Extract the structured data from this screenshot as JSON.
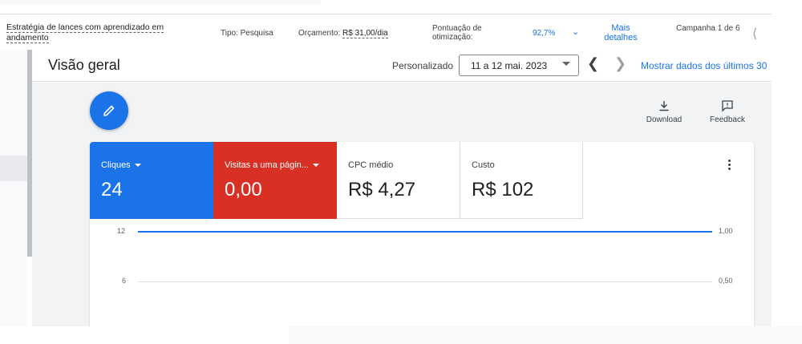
{
  "topbar": {
    "strategy": "Estratégia de lances com aprendizado em andamento",
    "type": "Tipo: Pesquisa",
    "budget_label": "Orçamento: ",
    "budget_value": "R$ 31,00/dia",
    "score_label": "Pontuação de otimização:",
    "score_value": "92,7%",
    "more_details": "Mais detalhes",
    "campaign": "Campanha 1 de 6"
  },
  "header": {
    "title": "Visão geral",
    "custom_label": "Personalizado",
    "date_range": "11 a 12 mai. 2023",
    "show_last": "Mostrar dados dos últimos 30"
  },
  "tools": {
    "download": "Download",
    "feedback": "Feedback"
  },
  "metrics": [
    {
      "label": "Cliques",
      "value": "24",
      "color": "#1a73e8"
    },
    {
      "label": "Visitas a uma págin...",
      "value": "0,00",
      "color": "#d93025"
    },
    {
      "label": "CPC médio",
      "value": "R$ 4,27"
    },
    {
      "label": "Custo",
      "value": "R$ 102"
    }
  ],
  "chart_data": {
    "type": "line",
    "left_axis_ticks": [
      "12",
      "6"
    ],
    "right_axis_ticks": [
      "1,00",
      "0,50"
    ],
    "series": [
      {
        "values": [
          12,
          12
        ]
      }
    ]
  },
  "colors": {
    "accent": "#1a73e8",
    "alert": "#d93025"
  }
}
